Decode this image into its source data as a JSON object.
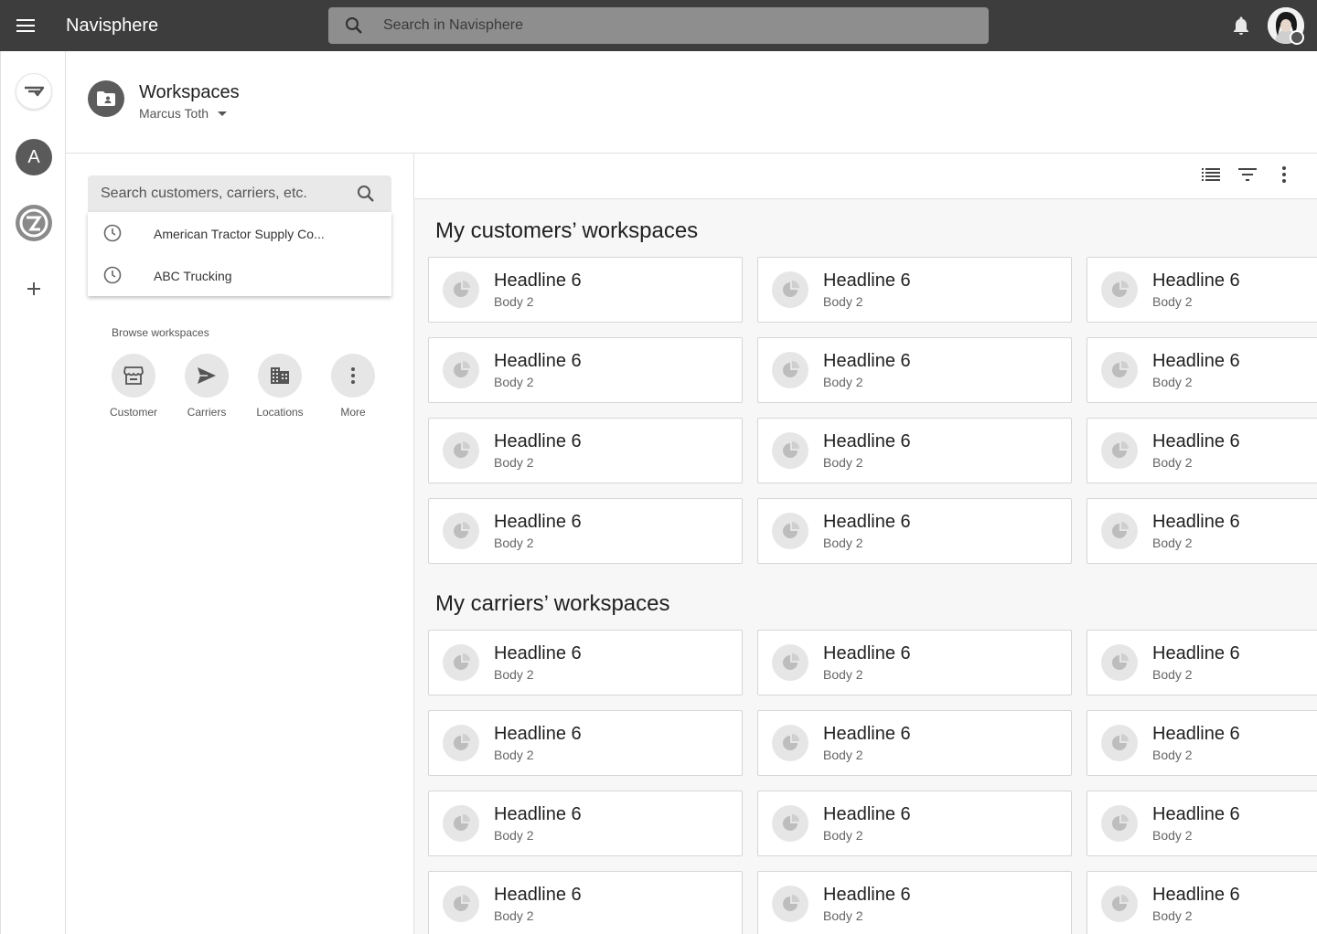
{
  "appbar": {
    "title": "Navisphere",
    "search_placeholder": "Search in Navisphere"
  },
  "rail": {
    "avatar_letter": "A"
  },
  "header": {
    "title": "Workspaces",
    "owner": "Marcus Toth"
  },
  "left_panel": {
    "search_placeholder": "Search customers, carriers, etc.",
    "recent": [
      {
        "label": "American Tractor Supply Co..."
      },
      {
        "label": "ABC Trucking"
      }
    ],
    "browse_label": "Browse workspaces",
    "browse_items": [
      {
        "label": "Customer",
        "icon": "storefront-icon"
      },
      {
        "label": "Carriers",
        "icon": "send-icon"
      },
      {
        "label": "Locations",
        "icon": "building-icon"
      },
      {
        "label": "More",
        "icon": "more-vertical-icon"
      }
    ]
  },
  "sections": [
    {
      "title": "My customers’ workspaces",
      "cards": [
        {
          "headline": "Headline 6",
          "body": "Body 2"
        },
        {
          "headline": "Headline 6",
          "body": "Body 2"
        },
        {
          "headline": "Headline 6",
          "body": "Body 2"
        },
        {
          "headline": "Headline 6",
          "body": "Body 2"
        },
        {
          "headline": "Headline 6",
          "body": "Body 2"
        },
        {
          "headline": "Headline 6",
          "body": "Body 2"
        },
        {
          "headline": "Headline 6",
          "body": "Body 2"
        },
        {
          "headline": "Headline 6",
          "body": "Body 2"
        },
        {
          "headline": "Headline 6",
          "body": "Body 2"
        },
        {
          "headline": "Headline 6",
          "body": "Body 2"
        },
        {
          "headline": "Headline 6",
          "body": "Body 2"
        },
        {
          "headline": "Headline 6",
          "body": "Body 2"
        }
      ]
    },
    {
      "title": "My carriers’ workspaces",
      "cards": [
        {
          "headline": "Headline 6",
          "body": "Body 2"
        },
        {
          "headline": "Headline 6",
          "body": "Body 2"
        },
        {
          "headline": "Headline 6",
          "body": "Body 2"
        },
        {
          "headline": "Headline 6",
          "body": "Body 2"
        },
        {
          "headline": "Headline 6",
          "body": "Body 2"
        },
        {
          "headline": "Headline 6",
          "body": "Body 2"
        },
        {
          "headline": "Headline 6",
          "body": "Body 2"
        },
        {
          "headline": "Headline 6",
          "body": "Body 2"
        },
        {
          "headline": "Headline 6",
          "body": "Body 2"
        },
        {
          "headline": "Headline 6",
          "body": "Body 2"
        },
        {
          "headline": "Headline 6",
          "body": "Body 2"
        },
        {
          "headline": "Headline 6",
          "body": "Body 2"
        }
      ]
    }
  ],
  "toolbar": {
    "icons": [
      "list-view-icon",
      "filter-icon",
      "more-vertical-icon"
    ]
  },
  "colors": {
    "appbar": "#3d3d3d",
    "search_bg": "#8e8e8e",
    "main_bg": "#f7f7f7"
  }
}
